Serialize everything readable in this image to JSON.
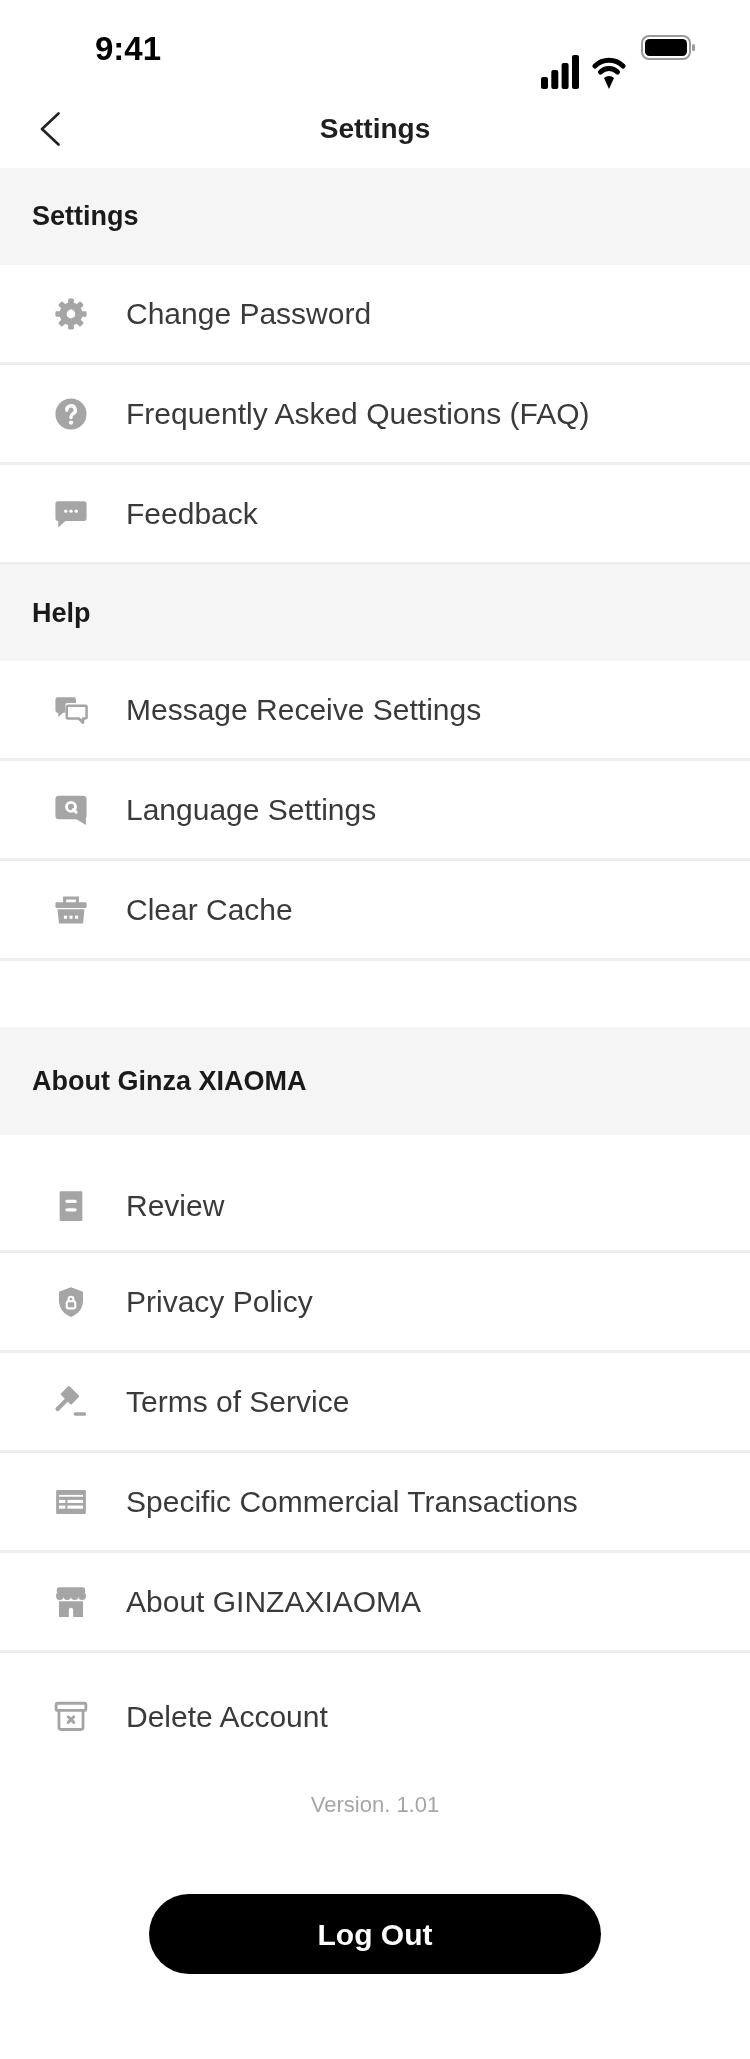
{
  "status_bar": {
    "time": "9:41"
  },
  "nav_bar": {
    "title": "Settings"
  },
  "sections": [
    {
      "title": "Settings",
      "items": [
        "Change Password",
        "Frequently Asked Questions (FAQ)",
        "Feedback"
      ]
    },
    {
      "title": "Help",
      "items": [
        "Message Receive Settings",
        "Language Settings",
        "Clear Cache"
      ]
    },
    {
      "title": "About Ginza XIAOMA",
      "items": [
        "Review",
        "Privacy Policy",
        "Terms of Service",
        "Specific Commercial Transactions",
        "About GINZAXIAOMA",
        "Delete Account"
      ]
    }
  ],
  "version": "Version. 1.01",
  "logout_button": "Log Out"
}
